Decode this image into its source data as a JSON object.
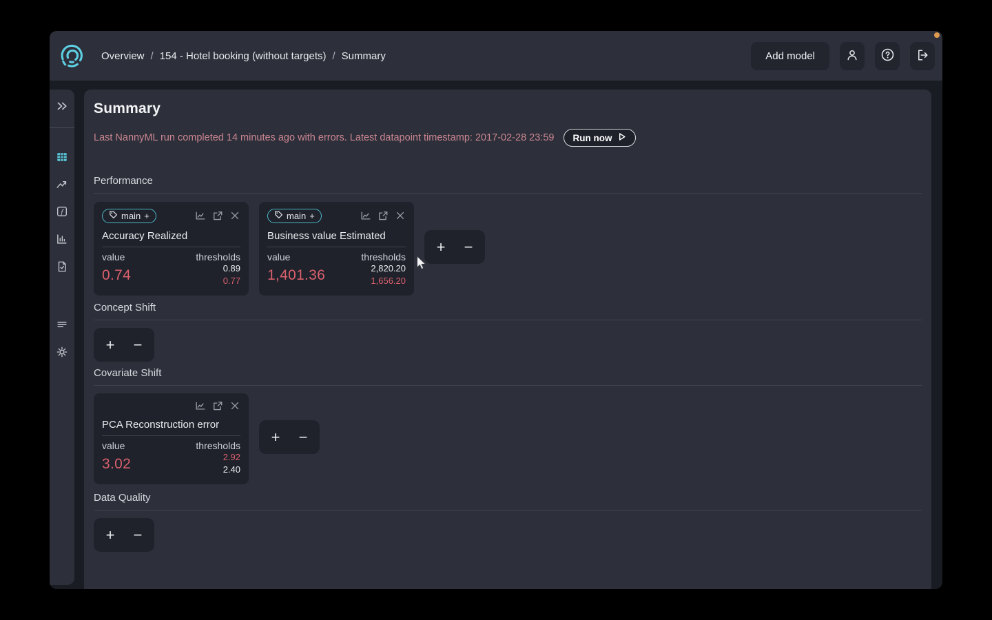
{
  "header": {
    "breadcrumb": [
      "Overview",
      "154 - Hotel booking (without targets)",
      "Summary"
    ],
    "separator": "/",
    "add_model": "Add model"
  },
  "summary": {
    "title": "Summary",
    "alert": "Last NannyML run completed 14 minutes ago with errors. Latest datapoint timestamp: 2017-02-28 23:59",
    "run_now": "Run now"
  },
  "tag": {
    "name": "main",
    "add": "+"
  },
  "card_labels": {
    "value": "value",
    "thresholds": "thresholds"
  },
  "controls": {
    "add": "+",
    "remove": "−"
  },
  "sections": {
    "performance": {
      "title": "Performance",
      "cards": [
        {
          "title": "Accuracy Realized",
          "value": "0.74",
          "threshold_upper": "0.89",
          "threshold_lower": "0.77"
        },
        {
          "title": "Business value Estimated",
          "value": "1,401.36",
          "threshold_upper": "2,820.20",
          "threshold_lower": "1,656.20"
        }
      ]
    },
    "concept_shift": {
      "title": "Concept Shift"
    },
    "covariate_shift": {
      "title": "Covariate Shift",
      "cards": [
        {
          "title": "PCA Reconstruction error",
          "value": "3.02",
          "threshold_upper": "2.92",
          "threshold_lower": "2.40"
        }
      ]
    },
    "data_quality": {
      "title": "Data Quality"
    }
  },
  "icons": {
    "logo": "nannyml-swirl-logo",
    "header": [
      "user-icon",
      "help-icon",
      "logout-icon"
    ],
    "sidebar": [
      "double-chevron-right-icon",
      "grid-icon",
      "trend-up-icon",
      "function-icon",
      "bar-chart-icon",
      "document-check-icon",
      "logs-icon",
      "gear-icon"
    ],
    "card": [
      "tag-icon",
      "sparkline-icon",
      "external-link-icon",
      "close-icon"
    ],
    "run_now": "play-icon"
  },
  "colors": {
    "accent_teal": "#4cb6c9",
    "active_icon_cyan": "#58c5d8",
    "error_red": "#d9606c",
    "alert_pink": "#ca8591",
    "notification_orange": "#de9a4f"
  }
}
